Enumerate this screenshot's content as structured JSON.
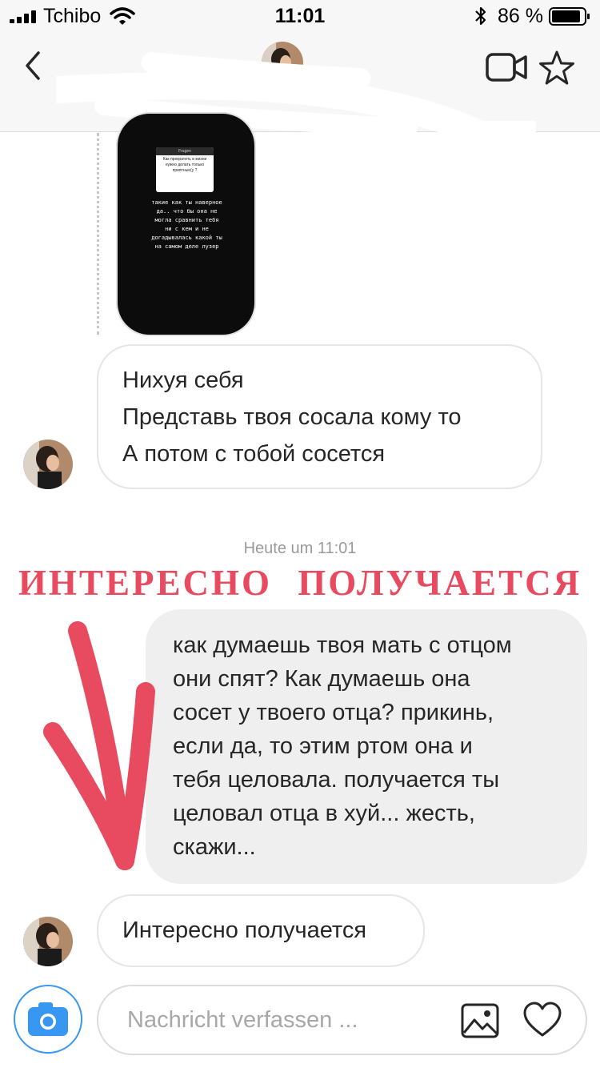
{
  "status_bar": {
    "carrier": "Tchibo",
    "time": "11:01",
    "battery": "86 %",
    "battery_level": 0.86
  },
  "header": {
    "icons": [
      "back-arrow-icon",
      "video-camera-icon",
      "star-icon"
    ]
  },
  "story_reply": {
    "prompt_header": "Fragen",
    "prompt_text": "Как прекратить в жизни нужно делать только приятные(у ?",
    "lines": [
      "такие как ты наверное",
      "да.. что бы она не",
      "могла сравнить тебя",
      "ни с кем и не",
      "догадывалась какой ты",
      "на самом деле лузер"
    ]
  },
  "messages": [
    {
      "direction": "incoming",
      "lines": [
        "Нихуя себя",
        "Представь твоя сосала кому то",
        "А потом с тобой сосется"
      ]
    },
    {
      "timestamp": "Heute um 11:01",
      "overlay_caption": "ИНТЕРЕСНО ПОЛУЧАЕТСЯ"
    },
    {
      "direction": "outgoing",
      "lines": [
        "как думаешь твоя мать с отцом",
        "они спят? Как думаешь она",
        "сосет у твоего отца? прикинь,",
        "если да, то этим ртом она и",
        "тебя целовала. получается ты",
        "целовал отца в хуй... жесть,",
        "скажи..."
      ]
    },
    {
      "direction": "incoming",
      "lines": [
        "Интересно получается"
      ]
    }
  ],
  "composer": {
    "placeholder": "Nachricht verfassen ...",
    "value": ""
  },
  "colors": {
    "accent_red": "#e84a5f",
    "camera_blue": "#3897f0",
    "outgoing_bubble": "#efefef",
    "bar_background": "#f7f7f7"
  }
}
